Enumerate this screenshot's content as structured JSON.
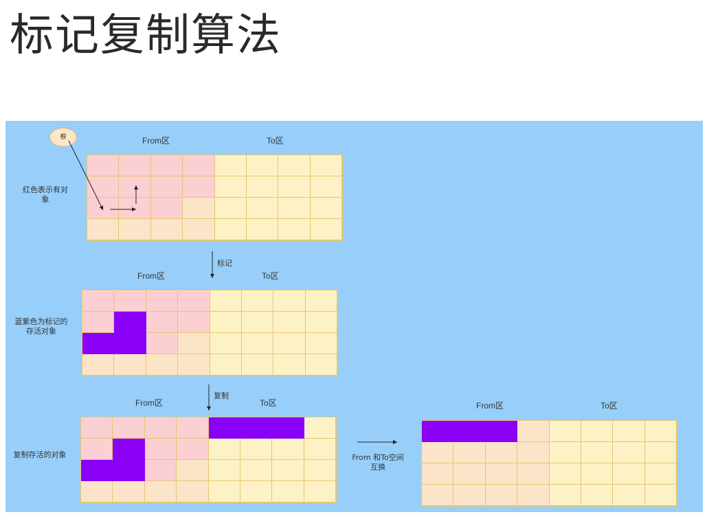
{
  "title": "标记复制算法",
  "root_label": "根",
  "stages": [
    {
      "side_label": "红色表示有对象",
      "from_label": "From区",
      "to_label": "To区",
      "grid": [
        "RRRRYYYY",
        "RRRRYYYY",
        "RRROYYYY",
        "OOOOYYYY"
      ]
    },
    {
      "side_label": "蓝紫色为标记的存活对象",
      "from_label": "From区",
      "to_label": "To区",
      "grid": [
        "RRRRYYYY",
        "RPRRYYYY",
        "PPROYYYY",
        "OOOOYYYY"
      ]
    },
    {
      "side_label": "复制存活的对象",
      "from_label": "From区",
      "to_label": "To区",
      "grid": [
        "RRRRPPPY",
        "RPRRYYYY",
        "PPROYYYY",
        "OOOOYYYY"
      ]
    },
    {
      "side_label": "",
      "from_label": "From区",
      "to_label": "To区",
      "grid": [
        "PPPOYYYY",
        "OOOOYYYY",
        "OOOOYYYY",
        "OOOOYYYY"
      ]
    }
  ],
  "arrows": {
    "mark": "标记",
    "copy": "复制",
    "swap": "From 和To空间互换"
  },
  "colors": {
    "R": "#fccfd2",
    "O": "#fbe4c8",
    "Y": "#fdf1c6",
    "P": "#8b00f7",
    "panel": "#97cffa"
  }
}
